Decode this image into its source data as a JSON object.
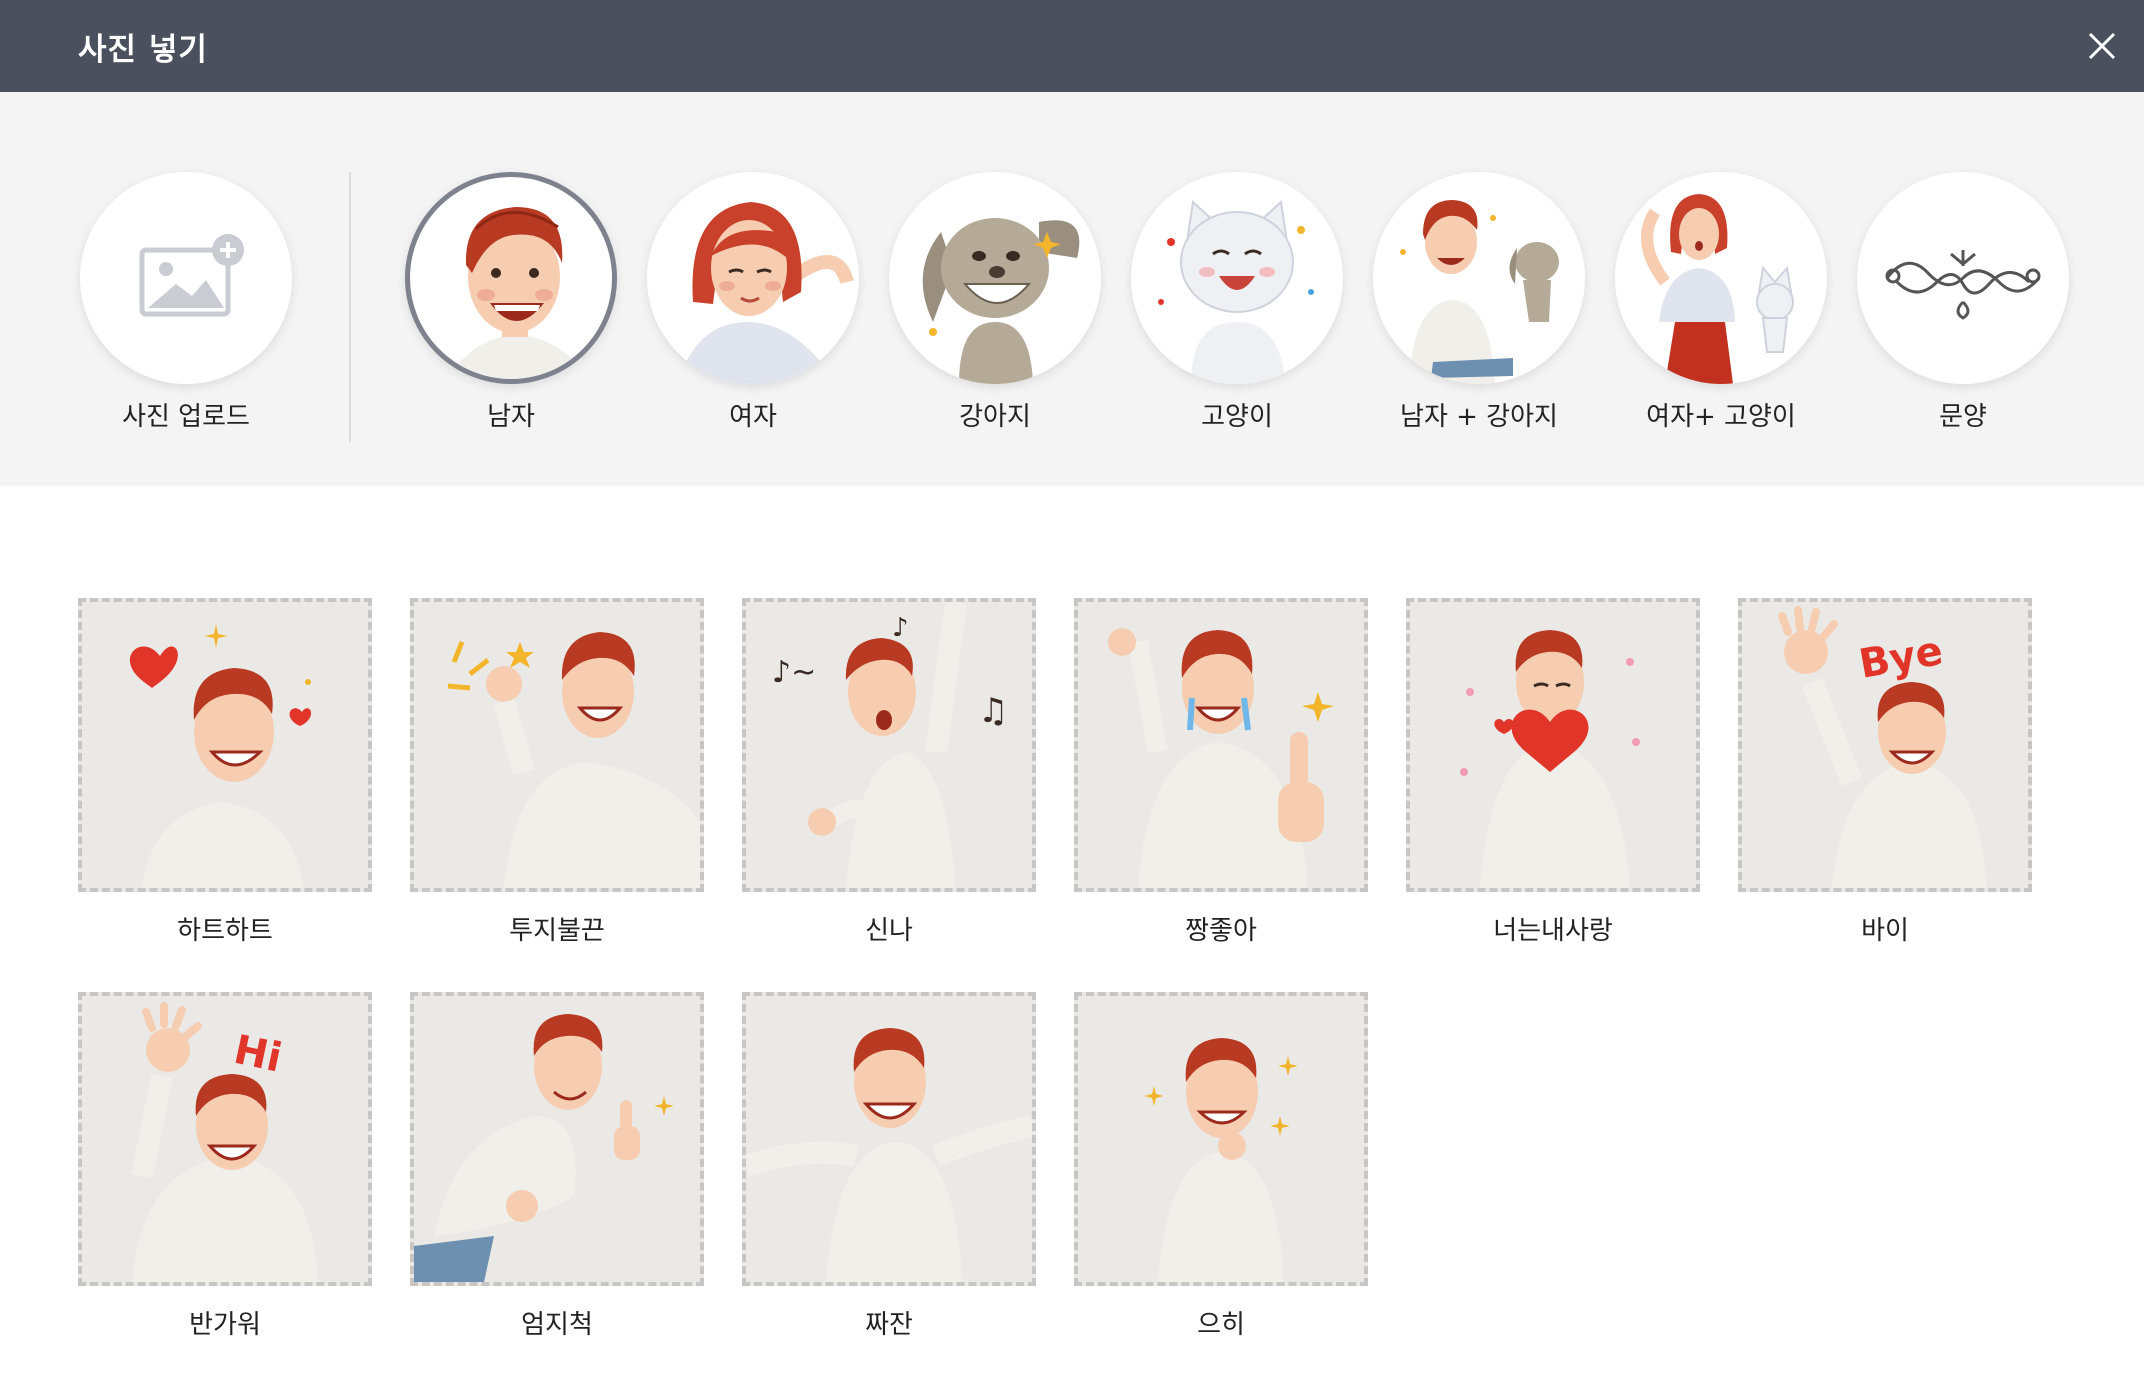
{
  "dialog": {
    "title": "사진 넣기"
  },
  "categories": {
    "upload_label": "사진 업로드",
    "items": [
      {
        "label": "남자",
        "selected": true
      },
      {
        "label": "여자"
      },
      {
        "label": "강아지"
      },
      {
        "label": "고양이"
      },
      {
        "label": "남자 + 강아지"
      },
      {
        "label": "여자+ 고양이"
      },
      {
        "label": "문양"
      }
    ]
  },
  "stickers": [
    {
      "label": "하트하트",
      "text": ""
    },
    {
      "label": "투지불끈",
      "text": ""
    },
    {
      "label": "신나",
      "text": ""
    },
    {
      "label": "짱좋아",
      "text": ""
    },
    {
      "label": "너는내사랑",
      "text": ""
    },
    {
      "label": "바이",
      "text": "Bye"
    },
    {
      "label": "반가워",
      "text": "Hi"
    },
    {
      "label": "엄지척",
      "text": ""
    },
    {
      "label": "짜잔",
      "text": ""
    },
    {
      "label": "으히",
      "text": ""
    }
  ],
  "colors": {
    "titlebar": "#4a505e",
    "panel": "#f4f4f4",
    "selected_ring": "#7d828e",
    "hair": "#b83a22",
    "skin": "#f6cdb0",
    "accent_red": "#e2352a"
  }
}
